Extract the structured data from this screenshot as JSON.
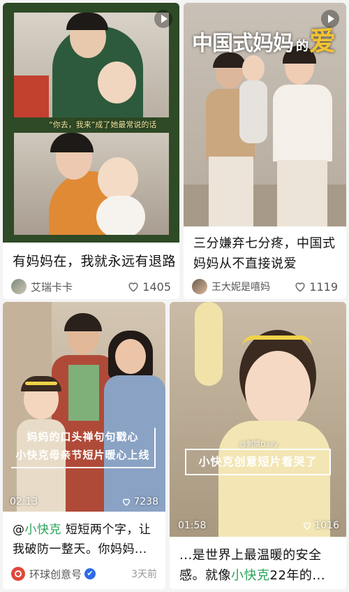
{
  "cards": [
    {
      "caption": "有妈妈在，我就永远有退路",
      "author": "艾瑞卡卡",
      "likes": "1405",
      "subtitle": "“你去，我来”成了她最常说的话"
    },
    {
      "caption": "三分嫌弃七分疼，中国式妈妈从不直接说爱",
      "author": "王大妮是嘻妈",
      "likes": "1119",
      "title_a": "中国式妈妈",
      "title_b": "的",
      "title_c": "爱"
    },
    {
      "caption_prefix": "@",
      "caption_link": "小快克",
      "caption_rest": " 短短两个字，让我破防一整天。你妈妈...",
      "author": "环球创意号",
      "verified": "✔",
      "time": "3天前",
      "duration": "02:13",
      "video_likes": "7238",
      "overlay_line1": "妈妈的口头禅句句戳心",
      "overlay_line2": "小快克母亲节短片暖心上线"
    },
    {
      "caption_prefix": "...是世界上最温暖的安全感。就像",
      "caption_link": "小快克",
      "caption_rest": "22年的...",
      "duration": "01:58",
      "video_likes": "1016",
      "overlay": "小快克创意短片看哭了",
      "watermark": "@刺猬Daily"
    }
  ],
  "colors": {
    "accent_green": "#2aa35a",
    "frame_green": "#2e4a26",
    "title_yellow": "#f2c230"
  }
}
